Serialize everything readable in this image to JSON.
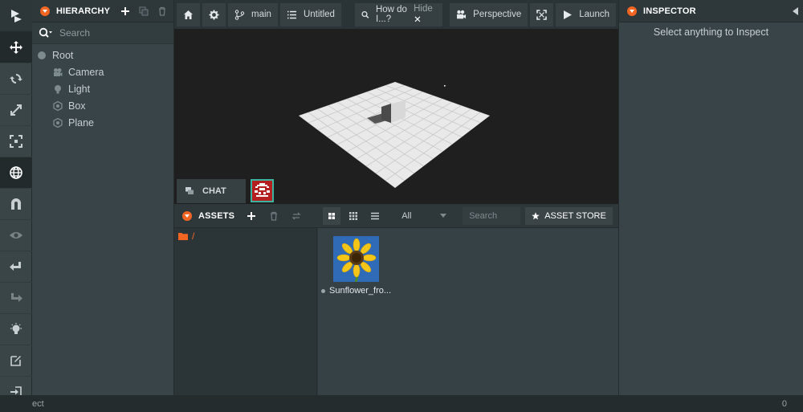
{
  "hierarchy": {
    "title": "HIERARCHY",
    "search_placeholder": "Search",
    "items": [
      {
        "label": "Root"
      },
      {
        "label": "Camera"
      },
      {
        "label": "Light"
      },
      {
        "label": "Box"
      },
      {
        "label": "Plane"
      }
    ]
  },
  "toolbar": {
    "branch_label": "main",
    "project_label": "Untitled",
    "help_search": "How do I...?",
    "help_hide": "Hide",
    "perspective_label": "Perspective",
    "launch_label": "Launch"
  },
  "viewport": {
    "chat_label": "CHAT"
  },
  "assets": {
    "title": "ASSETS",
    "filter_value": "All",
    "search_placeholder": "Search",
    "store_label": "ASSET STORE",
    "folder_path": "/",
    "files": [
      {
        "name": "Sunflower_fro..."
      }
    ]
  },
  "inspector": {
    "title": "INSPECTOR",
    "empty_message": "Select anything to Inspect"
  },
  "status": {
    "text": "ect",
    "count": "0"
  },
  "colors": {
    "accent": "#f26522",
    "panel": "#384447",
    "viewport_bg": "#1f1f1f"
  }
}
